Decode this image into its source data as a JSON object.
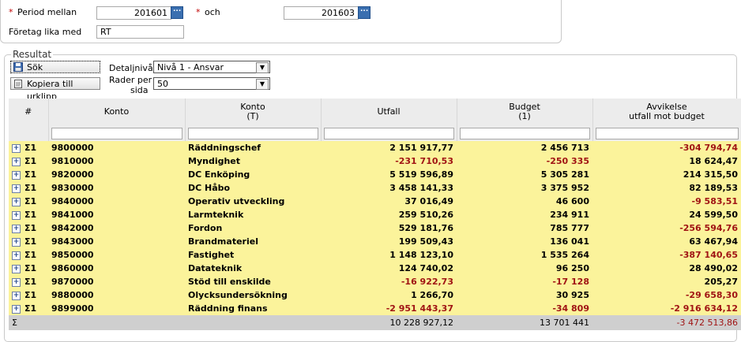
{
  "filter": {
    "period_label": "Period mellan",
    "period_from": "201601",
    "and_label": "och",
    "period_to": "201603",
    "company_label": "Företag lika med",
    "company_value": "RT"
  },
  "results": {
    "legend": "Resultat",
    "search_button": "Sök",
    "copy_button": "Kopiera till urklipp",
    "detail_label": "Detaljnivå",
    "detail_value": "Nivå 1 - Ansvar",
    "rows_label_1": "Rader per",
    "rows_label_2": "sida",
    "rows_value": "50"
  },
  "table": {
    "headers": [
      {
        "l1": "#",
        "l2": ""
      },
      {
        "l1": "Konto",
        "l2": ""
      },
      {
        "l1": "Konto",
        "l2": "(T)"
      },
      {
        "l1": "Utfall",
        "l2": ""
      },
      {
        "l1": "Budget",
        "l2": "(1)"
      },
      {
        "l1": "Avvikelse",
        "l2": "utfall mot budget"
      }
    ],
    "rows": [
      {
        "sigma": "Σ1",
        "konto": "9800000",
        "namn": "Räddningschef",
        "utfall": "2 151 917,77",
        "budget": "2 456 713",
        "avvikelse": "-304 794,74"
      },
      {
        "sigma": "Σ1",
        "konto": "9810000",
        "namn": "Myndighet",
        "utfall": "-231 710,53",
        "budget": "-250 335",
        "avvikelse": "18 624,47"
      },
      {
        "sigma": "Σ1",
        "konto": "9820000",
        "namn": "DC Enköping",
        "utfall": "5 519 596,89",
        "budget": "5 305 281",
        "avvikelse": "214 315,50"
      },
      {
        "sigma": "Σ1",
        "konto": "9830000",
        "namn": "DC Håbo",
        "utfall": "3 458 141,33",
        "budget": "3 375 952",
        "avvikelse": "82 189,53"
      },
      {
        "sigma": "Σ1",
        "konto": "9840000",
        "namn": "Operativ utveckling",
        "utfall": "37 016,49",
        "budget": "46 600",
        "avvikelse": "-9 583,51"
      },
      {
        "sigma": "Σ1",
        "konto": "9841000",
        "namn": "Larmteknik",
        "utfall": "259 510,26",
        "budget": "234 911",
        "avvikelse": "24 599,50"
      },
      {
        "sigma": "Σ1",
        "konto": "9842000",
        "namn": "Fordon",
        "utfall": "529 181,76",
        "budget": "785 777",
        "avvikelse": "-256 594,76"
      },
      {
        "sigma": "Σ1",
        "konto": "9843000",
        "namn": "Brandmateriel",
        "utfall": "199 509,43",
        "budget": "136 041",
        "avvikelse": "63 467,94"
      },
      {
        "sigma": "Σ1",
        "konto": "9850000",
        "namn": "Fastighet",
        "utfall": "1 148 123,10",
        "budget": "1 535 264",
        "avvikelse": "-387 140,65"
      },
      {
        "sigma": "Σ1",
        "konto": "9860000",
        "namn": "Datateknik",
        "utfall": "124 740,02",
        "budget": "96 250",
        "avvikelse": "28 490,02"
      },
      {
        "sigma": "Σ1",
        "konto": "9870000",
        "namn": "Stöd till enskilde",
        "utfall": "-16 922,73",
        "budget": "-17 128",
        "avvikelse": "205,27"
      },
      {
        "sigma": "Σ1",
        "konto": "9880000",
        "namn": "Olycksundersökning",
        "utfall": "1 266,70",
        "budget": "30 925",
        "avvikelse": "-29 658,30"
      },
      {
        "sigma": "Σ1",
        "konto": "9899000",
        "namn": "Räddning finans",
        "utfall": "-2 951 443,37",
        "budget": "-34 809",
        "avvikelse": "-2 916 634,12"
      }
    ],
    "sum": {
      "sigma": "Σ",
      "utfall": "10 228 927,12",
      "budget": "13 701 441",
      "avvikelse": "-3 472 513,86"
    }
  }
}
